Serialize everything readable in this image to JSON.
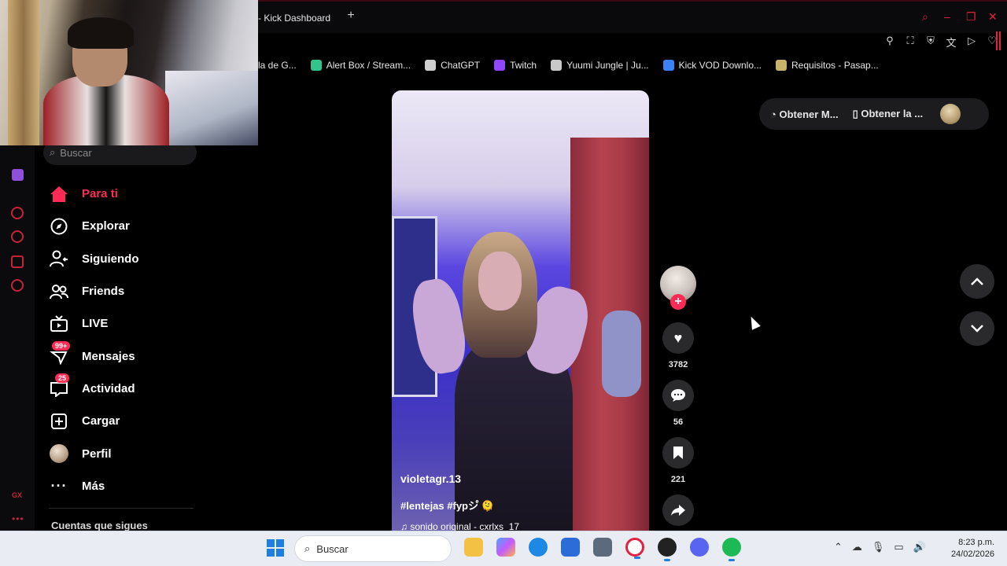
{
  "browser": {
    "active_tab": "Kick Dashboard",
    "bookmarks": [
      {
        "label": "la de G...",
        "color": "#a0a0a0"
      },
      {
        "label": "Alert Box / Stream...",
        "color": "#31c48d"
      },
      {
        "label": "ChatGPT",
        "color": "#cfcfcf"
      },
      {
        "label": "Twitch",
        "color": "#9146ff"
      },
      {
        "label": "Yuumi Jungle | Ju...",
        "color": "#c8c8c8"
      },
      {
        "label": "Kick VOD Downlo...",
        "color": "#3b82f6"
      },
      {
        "label": "Requisitos - Pasap...",
        "color": "#c9b36a"
      }
    ]
  },
  "sidebar": {
    "search_placeholder": "Buscar",
    "items": [
      {
        "label": "Para ti"
      },
      {
        "label": "Explorar"
      },
      {
        "label": "Siguiendo"
      },
      {
        "label": "Friends"
      },
      {
        "label": "LIVE"
      },
      {
        "label": "Mensajes",
        "badge": "99+"
      },
      {
        "label": "Actividad",
        "badge": "25"
      },
      {
        "label": "Cargar"
      },
      {
        "label": "Perfil"
      },
      {
        "label": "Más"
      }
    ],
    "following_title": "Cuentas que sigues"
  },
  "header": {
    "btn1": "Obtener M...",
    "btn2": "Obtener la ..."
  },
  "video": {
    "author": "violetagr.13",
    "description": "#lentejas #fypシ゚ 🫠",
    "sound": "♫ sonido original - cxrlxs_17"
  },
  "actions": {
    "likes": "3782",
    "comments": "56",
    "saves": "221"
  },
  "taskbar": {
    "search_placeholder": "Buscar",
    "time": "8:23 p.m.",
    "date": "24/02/2026"
  },
  "colors": {
    "accent": "#fe2c55",
    "opera_red": "#c4233b"
  }
}
